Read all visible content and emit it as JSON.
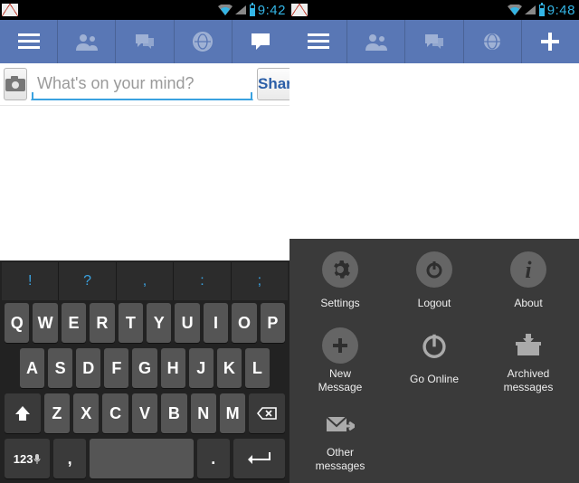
{
  "left": {
    "time": "9:42",
    "composer": {
      "placeholder": "What's on your mind?",
      "share_label": "Share"
    },
    "kbd": {
      "hints": [
        "!",
        "?",
        ",",
        ":",
        ";"
      ],
      "row1": [
        "Q",
        "W",
        "E",
        "R",
        "T",
        "Y",
        "U",
        "I",
        "O",
        "P"
      ],
      "row2": [
        "A",
        "S",
        "D",
        "F",
        "G",
        "H",
        "J",
        "K",
        "L"
      ],
      "row3": [
        "Z",
        "X",
        "C",
        "V",
        "B",
        "N",
        "M"
      ],
      "sym_label": "123",
      "comma": ",",
      "period": "."
    }
  },
  "right": {
    "time": "9:48",
    "sheet": [
      {
        "id": "settings",
        "label": "Settings",
        "icon": "gear"
      },
      {
        "id": "logout",
        "label": "Logout",
        "icon": "power"
      },
      {
        "id": "about",
        "label": "About",
        "icon": "info"
      },
      {
        "id": "new-message",
        "label": "New\nMessage",
        "icon": "plus"
      },
      {
        "id": "go-online",
        "label": "Go Online",
        "icon": "power-outline"
      },
      {
        "id": "archived",
        "label": "Archived\nmessages",
        "icon": "archive"
      },
      {
        "id": "other",
        "label": "Other\nmessages",
        "icon": "envelope"
      }
    ]
  }
}
